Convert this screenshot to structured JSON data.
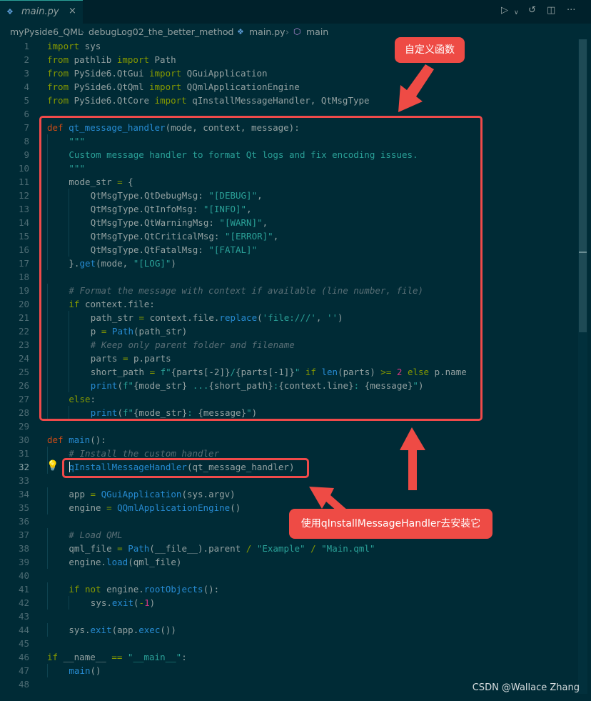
{
  "tab": {
    "label": "main.py",
    "close": "×",
    "file_icon": "python-file-icon"
  },
  "title_actions": [
    {
      "name": "run-button",
      "glyph": "▷"
    },
    {
      "name": "run-dropdown-chevron-icon",
      "glyph": "∨"
    },
    {
      "name": "open-changes-icon",
      "glyph": "↺"
    },
    {
      "name": "split-editor-icon",
      "glyph": "◫"
    },
    {
      "name": "more-actions-icon",
      "glyph": "···"
    }
  ],
  "breadcrumb": {
    "items": [
      "myPyside6_QML",
      "debugLog02_the_better_method",
      "main.py",
      "main"
    ],
    "separator": "›"
  },
  "code": {
    "active_line": 32,
    "lines": [
      {
        "n": 1,
        "indent": 0,
        "t": [
          [
            "kw",
            "import"
          ],
          [
            "p",
            " sys"
          ]
        ]
      },
      {
        "n": 2,
        "indent": 0,
        "t": [
          [
            "kw",
            "from"
          ],
          [
            "p",
            " pathlib "
          ],
          [
            "kw",
            "import"
          ],
          [
            "p",
            " Path"
          ]
        ]
      },
      {
        "n": 3,
        "indent": 0,
        "t": [
          [
            "kw",
            "from"
          ],
          [
            "p",
            " PySide6.QtGui "
          ],
          [
            "kw",
            "import"
          ],
          [
            "p",
            " QGuiApplication"
          ]
        ]
      },
      {
        "n": 4,
        "indent": 0,
        "t": [
          [
            "kw",
            "from"
          ],
          [
            "p",
            " PySide6.QtQml "
          ],
          [
            "kw",
            "import"
          ],
          [
            "p",
            " QQmlApplicationEngine"
          ]
        ]
      },
      {
        "n": 5,
        "indent": 0,
        "t": [
          [
            "kw",
            "from"
          ],
          [
            "p",
            " PySide6.QtCore "
          ],
          [
            "kw",
            "import"
          ],
          [
            "p",
            " qInstallMessageHandler, QtMsgType"
          ]
        ]
      },
      {
        "n": 6,
        "indent": 0,
        "t": []
      },
      {
        "n": 7,
        "indent": 0,
        "t": [
          [
            "def",
            "def"
          ],
          [
            "p",
            " "
          ],
          [
            "fn",
            "qt_message_handler"
          ],
          [
            "p",
            "(mode, context, message):"
          ]
        ]
      },
      {
        "n": 8,
        "indent": 1,
        "t": [
          [
            "str",
            "\"\"\""
          ]
        ]
      },
      {
        "n": 9,
        "indent": 1,
        "t": [
          [
            "str",
            "Custom message handler to format Qt logs and fix encoding issues."
          ]
        ]
      },
      {
        "n": 10,
        "indent": 1,
        "t": [
          [
            "str",
            "\"\"\""
          ]
        ]
      },
      {
        "n": 11,
        "indent": 1,
        "t": [
          [
            "p",
            "mode_str "
          ],
          [
            "op",
            "="
          ],
          [
            "p",
            " {"
          ]
        ]
      },
      {
        "n": 12,
        "indent": 2,
        "t": [
          [
            "p",
            "QtMsgType.QtDebugMsg: "
          ],
          [
            "str",
            "\"[DEBUG]\""
          ],
          [
            "p",
            ","
          ]
        ]
      },
      {
        "n": 13,
        "indent": 2,
        "t": [
          [
            "p",
            "QtMsgType.QtInfoMsg: "
          ],
          [
            "str",
            "\"[INFO]\""
          ],
          [
            "p",
            ","
          ]
        ]
      },
      {
        "n": 14,
        "indent": 2,
        "t": [
          [
            "p",
            "QtMsgType.QtWarningMsg: "
          ],
          [
            "str",
            "\"[WARN]\""
          ],
          [
            "p",
            ","
          ]
        ]
      },
      {
        "n": 15,
        "indent": 2,
        "t": [
          [
            "p",
            "QtMsgType.QtCriticalMsg: "
          ],
          [
            "str",
            "\"[ERROR]\""
          ],
          [
            "p",
            ","
          ]
        ]
      },
      {
        "n": 16,
        "indent": 2,
        "t": [
          [
            "p",
            "QtMsgType.QtFatalMsg: "
          ],
          [
            "str",
            "\"[FATAL]\""
          ]
        ]
      },
      {
        "n": 17,
        "indent": 1,
        "t": [
          [
            "p",
            "}."
          ],
          [
            "fn",
            "get"
          ],
          [
            "p",
            "(mode, "
          ],
          [
            "str",
            "\"[LOG]\""
          ],
          [
            "p",
            ")"
          ]
        ]
      },
      {
        "n": 18,
        "indent": 0,
        "t": []
      },
      {
        "n": 19,
        "indent": 1,
        "t": [
          [
            "com",
            "# Format the message with context if available (line number, file)"
          ]
        ]
      },
      {
        "n": 20,
        "indent": 1,
        "t": [
          [
            "kw",
            "if"
          ],
          [
            "p",
            " context.file:"
          ]
        ]
      },
      {
        "n": 21,
        "indent": 2,
        "t": [
          [
            "p",
            "path_str "
          ],
          [
            "op",
            "="
          ],
          [
            "p",
            " context.file."
          ],
          [
            "fn",
            "replace"
          ],
          [
            "p",
            "("
          ],
          [
            "str",
            "'file:///'"
          ],
          [
            "p",
            ", "
          ],
          [
            "str",
            "''"
          ],
          [
            "p",
            ")"
          ]
        ]
      },
      {
        "n": 22,
        "indent": 2,
        "t": [
          [
            "p",
            "p "
          ],
          [
            "op",
            "="
          ],
          [
            "p",
            " "
          ],
          [
            "fn",
            "Path"
          ],
          [
            "p",
            "(path_str)"
          ]
        ]
      },
      {
        "n": 23,
        "indent": 2,
        "t": [
          [
            "com",
            "# Keep only parent folder and filename"
          ]
        ]
      },
      {
        "n": 24,
        "indent": 2,
        "t": [
          [
            "p",
            "parts "
          ],
          [
            "op",
            "="
          ],
          [
            "p",
            " p.parts"
          ]
        ]
      },
      {
        "n": 25,
        "indent": 2,
        "t": [
          [
            "p",
            "short_path "
          ],
          [
            "op",
            "="
          ],
          [
            "p",
            " "
          ],
          [
            "str",
            "f\""
          ],
          [
            "p",
            "{parts[-2]}"
          ],
          [
            "str",
            "/"
          ],
          [
            "p",
            "{parts[-1]}"
          ],
          [
            "str",
            "\""
          ],
          [
            "p",
            " "
          ],
          [
            "kw",
            "if"
          ],
          [
            "p",
            " "
          ],
          [
            "fn",
            "len"
          ],
          [
            "p",
            "(parts) "
          ],
          [
            "op",
            ">="
          ],
          [
            "p",
            " "
          ],
          [
            "num",
            "2"
          ],
          [
            "p",
            " "
          ],
          [
            "kw",
            "else"
          ],
          [
            "p",
            " p.name"
          ]
        ]
      },
      {
        "n": 26,
        "indent": 2,
        "t": [
          [
            "fn",
            "print"
          ],
          [
            "p",
            "("
          ],
          [
            "str",
            "f\""
          ],
          [
            "p",
            "{mode_str}"
          ],
          [
            "str",
            " ..."
          ],
          [
            "p",
            "{short_path}"
          ],
          [
            "str",
            ":"
          ],
          [
            "p",
            "{context.line}"
          ],
          [
            "str",
            ": "
          ],
          [
            "p",
            "{message}"
          ],
          [
            "str",
            "\""
          ],
          [
            "p",
            ")"
          ]
        ]
      },
      {
        "n": 27,
        "indent": 1,
        "t": [
          [
            "kw",
            "else"
          ],
          [
            "p",
            ":"
          ]
        ]
      },
      {
        "n": 28,
        "indent": 2,
        "t": [
          [
            "fn",
            "print"
          ],
          [
            "p",
            "("
          ],
          [
            "str",
            "f\""
          ],
          [
            "p",
            "{mode_str}"
          ],
          [
            "str",
            ": "
          ],
          [
            "p",
            "{message}"
          ],
          [
            "str",
            "\""
          ],
          [
            "p",
            ")"
          ]
        ]
      },
      {
        "n": 29,
        "indent": 0,
        "t": []
      },
      {
        "n": 30,
        "indent": 0,
        "t": [
          [
            "def",
            "def"
          ],
          [
            "p",
            " "
          ],
          [
            "fn",
            "main"
          ],
          [
            "p",
            "():"
          ]
        ]
      },
      {
        "n": 31,
        "indent": 1,
        "t": [
          [
            "com",
            "# Install the custom handler"
          ]
        ]
      },
      {
        "n": 32,
        "indent": 1,
        "t": [
          [
            "fn",
            "qInstallMessageHandler"
          ],
          [
            "p",
            "(qt_message_handler)"
          ]
        ]
      },
      {
        "n": 33,
        "indent": 0,
        "t": []
      },
      {
        "n": 34,
        "indent": 1,
        "t": [
          [
            "p",
            "app "
          ],
          [
            "op",
            "="
          ],
          [
            "p",
            " "
          ],
          [
            "fn",
            "QGuiApplication"
          ],
          [
            "p",
            "(sys.argv)"
          ]
        ]
      },
      {
        "n": 35,
        "indent": 1,
        "t": [
          [
            "p",
            "engine "
          ],
          [
            "op",
            "="
          ],
          [
            "p",
            " "
          ],
          [
            "fn",
            "QQmlApplicationEngine"
          ],
          [
            "p",
            "()"
          ]
        ]
      },
      {
        "n": 36,
        "indent": 0,
        "t": []
      },
      {
        "n": 37,
        "indent": 1,
        "t": [
          [
            "com",
            "# Load QML"
          ]
        ]
      },
      {
        "n": 38,
        "indent": 1,
        "t": [
          [
            "p",
            "qml_file "
          ],
          [
            "op",
            "="
          ],
          [
            "p",
            " "
          ],
          [
            "fn",
            "Path"
          ],
          [
            "p",
            "(__file__).parent "
          ],
          [
            "op",
            "/"
          ],
          [
            "p",
            " "
          ],
          [
            "str",
            "\"Example\""
          ],
          [
            "p",
            " "
          ],
          [
            "op",
            "/"
          ],
          [
            "p",
            " "
          ],
          [
            "str",
            "\"Main.qml\""
          ]
        ]
      },
      {
        "n": 39,
        "indent": 1,
        "t": [
          [
            "p",
            "engine."
          ],
          [
            "fn",
            "load"
          ],
          [
            "p",
            "(qml_file)"
          ]
        ]
      },
      {
        "n": 40,
        "indent": 0,
        "t": []
      },
      {
        "n": 41,
        "indent": 1,
        "t": [
          [
            "kw",
            "if"
          ],
          [
            "p",
            " "
          ],
          [
            "kw",
            "not"
          ],
          [
            "p",
            " engine."
          ],
          [
            "fn",
            "rootObjects"
          ],
          [
            "p",
            "():"
          ]
        ]
      },
      {
        "n": 42,
        "indent": 2,
        "t": [
          [
            "p",
            "sys."
          ],
          [
            "fn",
            "exit"
          ],
          [
            "p",
            "("
          ],
          [
            "op",
            "-"
          ],
          [
            "num",
            "1"
          ],
          [
            "p",
            ")"
          ]
        ]
      },
      {
        "n": 43,
        "indent": 0,
        "t": []
      },
      {
        "n": 44,
        "indent": 1,
        "t": [
          [
            "p",
            "sys."
          ],
          [
            "fn",
            "exit"
          ],
          [
            "p",
            "(app."
          ],
          [
            "fn",
            "exec"
          ],
          [
            "p",
            "())"
          ]
        ]
      },
      {
        "n": 45,
        "indent": 0,
        "t": []
      },
      {
        "n": 46,
        "indent": 0,
        "t": [
          [
            "kw",
            "if"
          ],
          [
            "p",
            " __name__ "
          ],
          [
            "op",
            "=="
          ],
          [
            "p",
            " "
          ],
          [
            "str",
            "\"__main__\""
          ],
          [
            "p",
            ":"
          ]
        ]
      },
      {
        "n": 47,
        "indent": 1,
        "t": [
          [
            "fn",
            "main"
          ],
          [
            "p",
            "()"
          ]
        ]
      },
      {
        "n": 48,
        "indent": 0,
        "t": []
      }
    ]
  },
  "annotations": {
    "callout_top": "自定义函数",
    "callout_bottom": "使用qInstallMessageHandler去安装它"
  },
  "watermark": "CSDN @Wallace Zhang",
  "colors": {
    "background": "#002b36",
    "keyword": "#859900",
    "def": "#cb4b16",
    "function": "#268bd2",
    "string": "#2aa198",
    "comment": "#586e75",
    "number": "#d33682",
    "plain": "#93a1a1",
    "annotation_red": "#ee4b45"
  }
}
